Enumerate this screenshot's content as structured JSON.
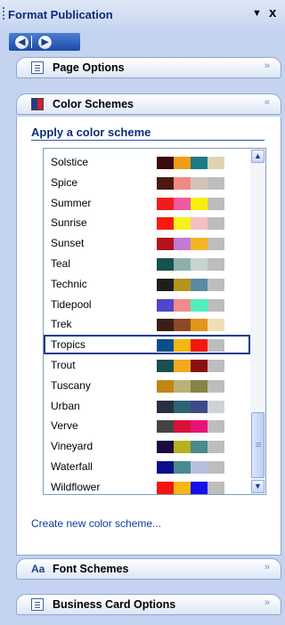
{
  "title_bar": {
    "title": "Format Publication",
    "dropdown_glyph": "▼",
    "close_glyph": "x"
  },
  "nav": {
    "back_icon": "back-arrow-icon",
    "forward_icon": "forward-arrow-icon",
    "back_glyph": "◀",
    "forward_glyph": "▶"
  },
  "sections": {
    "page_options": {
      "label": "Page Options",
      "chevron": "»"
    },
    "color_schemes": {
      "label": "Color Schemes",
      "chevron": "«"
    },
    "font_schemes": {
      "label": "Font Schemes",
      "icon_text": "Aa",
      "chevron": "»"
    },
    "business_card_options": {
      "label": "Business Card Options",
      "chevron": "»"
    }
  },
  "color_schemes_panel": {
    "heading": "Apply a color scheme",
    "selected": "Tropics",
    "schemes": [
      {
        "name": "Solstice",
        "colors": [
          "#3b0b0b",
          "#f39c11",
          "#1a7a8a",
          "#ded4b3"
        ]
      },
      {
        "name": "Spice",
        "colors": [
          "#4a1a12",
          "#f08a82",
          "#d4c4b8",
          "#bdbdbd"
        ]
      },
      {
        "name": "Summer",
        "colors": [
          "#f01c1c",
          "#ee5aa0",
          "#f8f00a",
          "#bdbdbd"
        ]
      },
      {
        "name": "Sunrise",
        "colors": [
          "#f81a0c",
          "#f7f21b",
          "#f4bfc0",
          "#bdbdbd"
        ]
      },
      {
        "name": "Sunset",
        "colors": [
          "#b5131c",
          "#c07ad8",
          "#f3b526",
          "#bdbdbd"
        ]
      },
      {
        "name": "Teal",
        "colors": [
          "#16524d",
          "#8fb0a9",
          "#c6d4d2",
          "#bdbdbd"
        ]
      },
      {
        "name": "Technic",
        "colors": [
          "#1e1e1e",
          "#b3951a",
          "#5a8aa3",
          "#bdbdbd"
        ]
      },
      {
        "name": "Tidepool",
        "colors": [
          "#5046c8",
          "#f08c8c",
          "#50efbd",
          "#bdbdbd"
        ]
      },
      {
        "name": "Trek",
        "colors": [
          "#3a2014",
          "#8e4a25",
          "#e2941f",
          "#f0dfb5"
        ]
      },
      {
        "name": "Tropics",
        "colors": [
          "#0a4e8a",
          "#f3b710",
          "#f1180f",
          "#bdbdbd"
        ]
      },
      {
        "name": "Trout",
        "colors": [
          "#1a4e50",
          "#f2a91c",
          "#8c1010",
          "#bdbdbd"
        ]
      },
      {
        "name": "Tuscany",
        "colors": [
          "#c08612",
          "#b9b17a",
          "#878344",
          "#bdbdbd"
        ]
      },
      {
        "name": "Urban",
        "colors": [
          "#2a2e43",
          "#2d6472",
          "#3f4a88",
          "#cfd2d8"
        ]
      },
      {
        "name": "Verve",
        "colors": [
          "#444444",
          "#d8123a",
          "#e8127a",
          "#bdbdbd"
        ]
      },
      {
        "name": "Vineyard",
        "colors": [
          "#1c0a3e",
          "#b5b21f",
          "#4a8a8a",
          "#bdbdbd"
        ]
      },
      {
        "name": "Waterfall",
        "colors": [
          "#0a0f8a",
          "#4a8a8e",
          "#b7bfe0",
          "#bdbdbd"
        ]
      },
      {
        "name": "Wildflower",
        "colors": [
          "#f3130f",
          "#f6b810",
          "#140fe8",
          "#bdbdbd"
        ]
      }
    ],
    "create_link": "Create new color scheme..."
  }
}
